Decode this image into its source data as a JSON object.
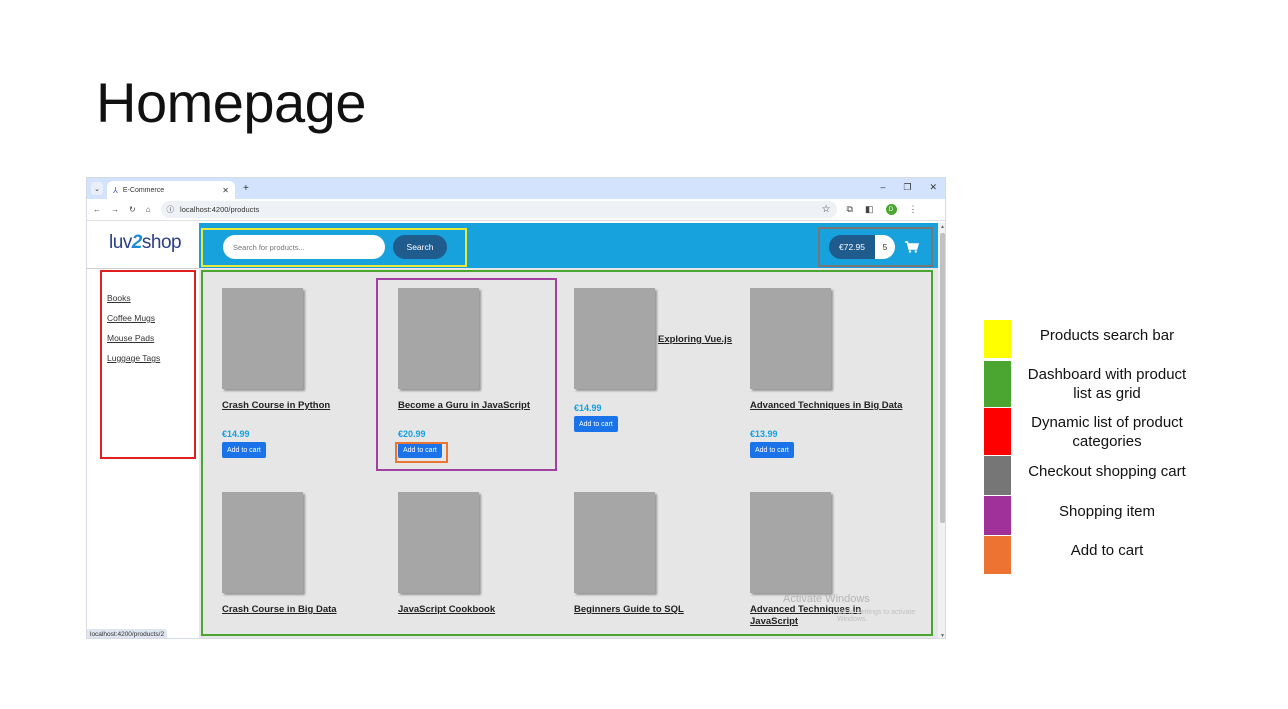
{
  "slide": {
    "title": "Homepage"
  },
  "browser": {
    "tab_title": "E-Commerce",
    "tab_dropdown": "⌄",
    "new_tab": "+",
    "win_min": "–",
    "win_restore": "❐",
    "win_close": "✕",
    "url": "localhost:4200/products",
    "status_url": "localhost:4200/products/2",
    "profile_initial": "D"
  },
  "app": {
    "logo_left": "luv",
    "logo_mid": "2",
    "logo_right": "shop",
    "search": {
      "placeholder": "Search for products...",
      "button_label": "Search"
    },
    "cart": {
      "total": "€72.95",
      "quantity": "5",
      "icon": "shopping-cart-icon"
    },
    "categories": [
      "Books",
      "Coffee Mugs",
      "Mouse Pads",
      "Luggage Tags"
    ],
    "products": [
      {
        "name": "Crash Course in Python",
        "price": "€14.99",
        "button": "Add to cart"
      },
      {
        "name": "Become a Guru in JavaScript",
        "price": "€20.99",
        "button": "Add to cart"
      },
      {
        "name": "Exploring Vue.js",
        "price": "€14.99",
        "button": "Add to cart"
      },
      {
        "name": "Advanced Techniques in Big Data",
        "price": "€13.99",
        "button": "Add to cart"
      },
      {
        "name": "Crash Course in Big Data",
        "price": "",
        "button": ""
      },
      {
        "name": "JavaScript Cookbook",
        "price": "",
        "button": ""
      },
      {
        "name": "Beginners Guide to SQL",
        "price": "",
        "button": ""
      },
      {
        "name": "Advanced Techniques in JavaScript",
        "price": "",
        "button": ""
      }
    ],
    "watermark": "Activate Windows",
    "watermark_sub": "Go to Settings to activate Windows."
  },
  "legend": {
    "items": [
      {
        "label": "Products search bar",
        "color": "#ffff00"
      },
      {
        "label": "Dashboard with product list as grid",
        "color": "#4aa531"
      },
      {
        "label": "Dynamic list of product categories",
        "color": "#ff0000"
      },
      {
        "label": "Checkout shopping cart",
        "color": "#767676"
      },
      {
        "label": "Shopping item",
        "color": "#a0309a"
      },
      {
        "label": "Add to cart",
        "color": "#ed7332"
      }
    ]
  }
}
